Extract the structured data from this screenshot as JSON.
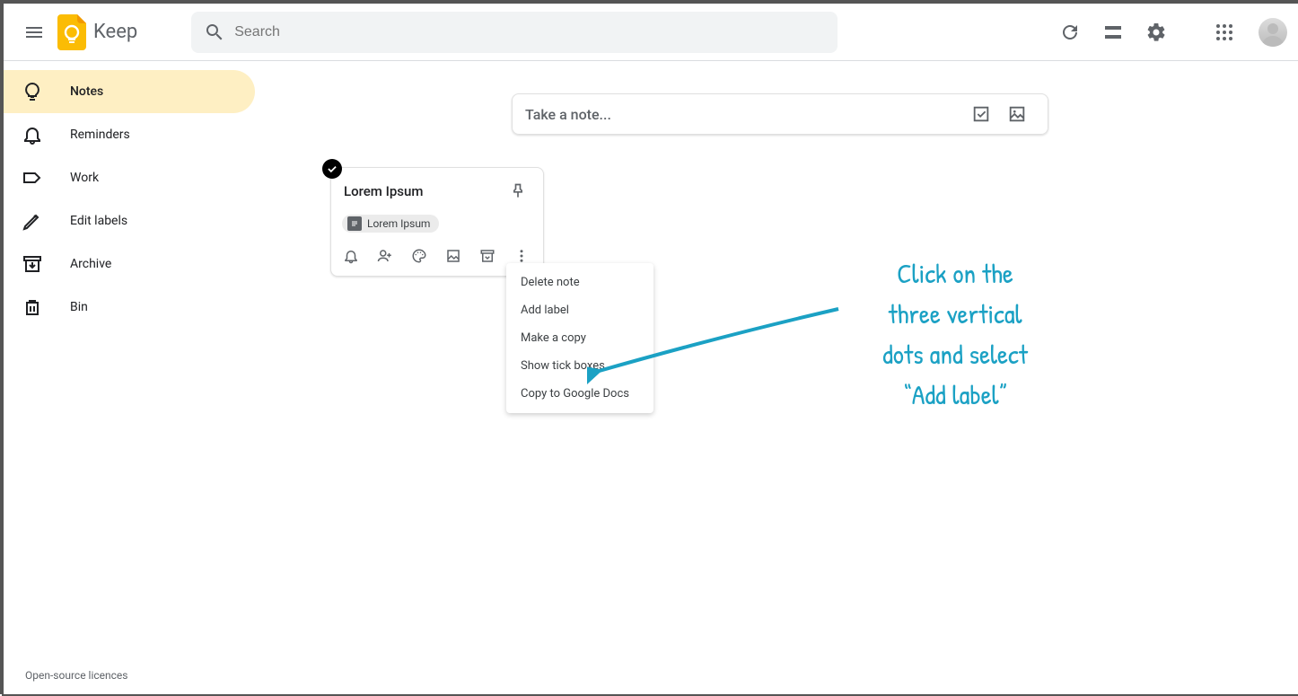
{
  "header": {
    "app_name": "Keep",
    "search_placeholder": "Search"
  },
  "sidebar": {
    "items": [
      {
        "label": "Notes"
      },
      {
        "label": "Reminders"
      },
      {
        "label": "Work"
      },
      {
        "label": "Edit labels"
      },
      {
        "label": "Archive"
      },
      {
        "label": "Bin"
      }
    ],
    "footer": "Open-source licences"
  },
  "take_note": {
    "placeholder": "Take a note..."
  },
  "note": {
    "title": "Lorem Ipsum",
    "label": "Lorem Ipsum"
  },
  "dropdown": {
    "items": [
      "Delete note",
      "Add label",
      "Make a copy",
      "Show tick boxes",
      "Copy to Google Docs"
    ]
  },
  "annotation": "Click on the\nthree vertical\ndots and select\n“Add label”"
}
